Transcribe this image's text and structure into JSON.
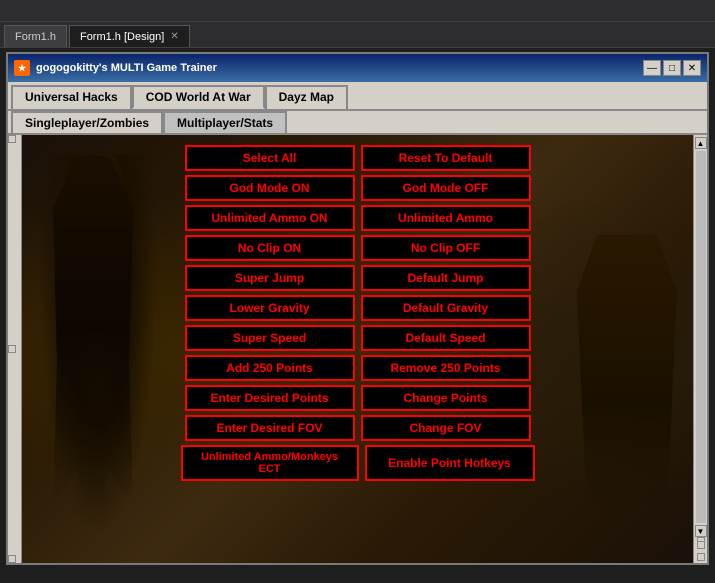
{
  "vs": {
    "titlebar_text": "",
    "tabs": [
      {
        "label": "Form1.h",
        "active": false,
        "closable": false
      },
      {
        "label": "Form1.h [Design]",
        "active": true,
        "closable": true
      }
    ]
  },
  "app": {
    "title": "gogogokitty's MULTI Game Trainer",
    "icon": "★",
    "titlebar_controls": {
      "minimize": "—",
      "maximize": "□",
      "close": "✕"
    },
    "menu_tabs": [
      {
        "label": "Universal Hacks",
        "active": false
      },
      {
        "label": "COD World At War",
        "active": true
      },
      {
        "label": "Dayz Map",
        "active": false
      }
    ],
    "sub_tabs": [
      {
        "label": "Singleplayer/Zombies",
        "active": true
      },
      {
        "label": "Multiplayer/Stats",
        "active": false
      }
    ]
  },
  "buttons": {
    "row1": [
      {
        "label": "Select All",
        "id": "select-all"
      },
      {
        "label": "Reset To Default",
        "id": "reset-default"
      }
    ],
    "row2": [
      {
        "label": "God Mode ON",
        "id": "god-mode-on"
      },
      {
        "label": "God Mode OFF",
        "id": "god-mode-off"
      }
    ],
    "row3": [
      {
        "label": "Unlimited Ammo ON",
        "id": "unlimited-ammo-on"
      },
      {
        "label": "Unlimited Ammo",
        "id": "unlimited-ammo"
      }
    ],
    "row4": [
      {
        "label": "No Clip ON",
        "id": "no-clip-on"
      },
      {
        "label": "No Clip OFF",
        "id": "no-clip-off"
      }
    ],
    "row5": [
      {
        "label": "Super Jump",
        "id": "super-jump"
      },
      {
        "label": "Default Jump",
        "id": "default-jump"
      }
    ],
    "row6": [
      {
        "label": "Lower Gravity",
        "id": "lower-gravity"
      },
      {
        "label": "Default Gravity",
        "id": "default-gravity"
      }
    ],
    "row7": [
      {
        "label": "Super Speed",
        "id": "super-speed"
      },
      {
        "label": "Default Speed",
        "id": "default-speed"
      }
    ],
    "row8": [
      {
        "label": "Add 250 Points",
        "id": "add-250-points"
      },
      {
        "label": "Remove 250 Points",
        "id": "remove-250-points"
      }
    ],
    "row9": [
      {
        "label": "Enter Desired Points",
        "id": "enter-desired-points"
      },
      {
        "label": "Change Points",
        "id": "change-points"
      }
    ],
    "row10": [
      {
        "label": "Enter Desired FOV",
        "id": "enter-desired-fov"
      },
      {
        "label": "Change FOV",
        "id": "change-fov"
      }
    ],
    "row11": [
      {
        "label": "Unlimited Ammo/Monkeys ECT",
        "id": "unlimited-ammo-monkeys"
      },
      {
        "label": "Enable Point Hotkeys",
        "id": "enable-point-hotkeys"
      }
    ]
  },
  "scroll": {
    "up_arrow": "▲",
    "down_arrow": "▼"
  }
}
